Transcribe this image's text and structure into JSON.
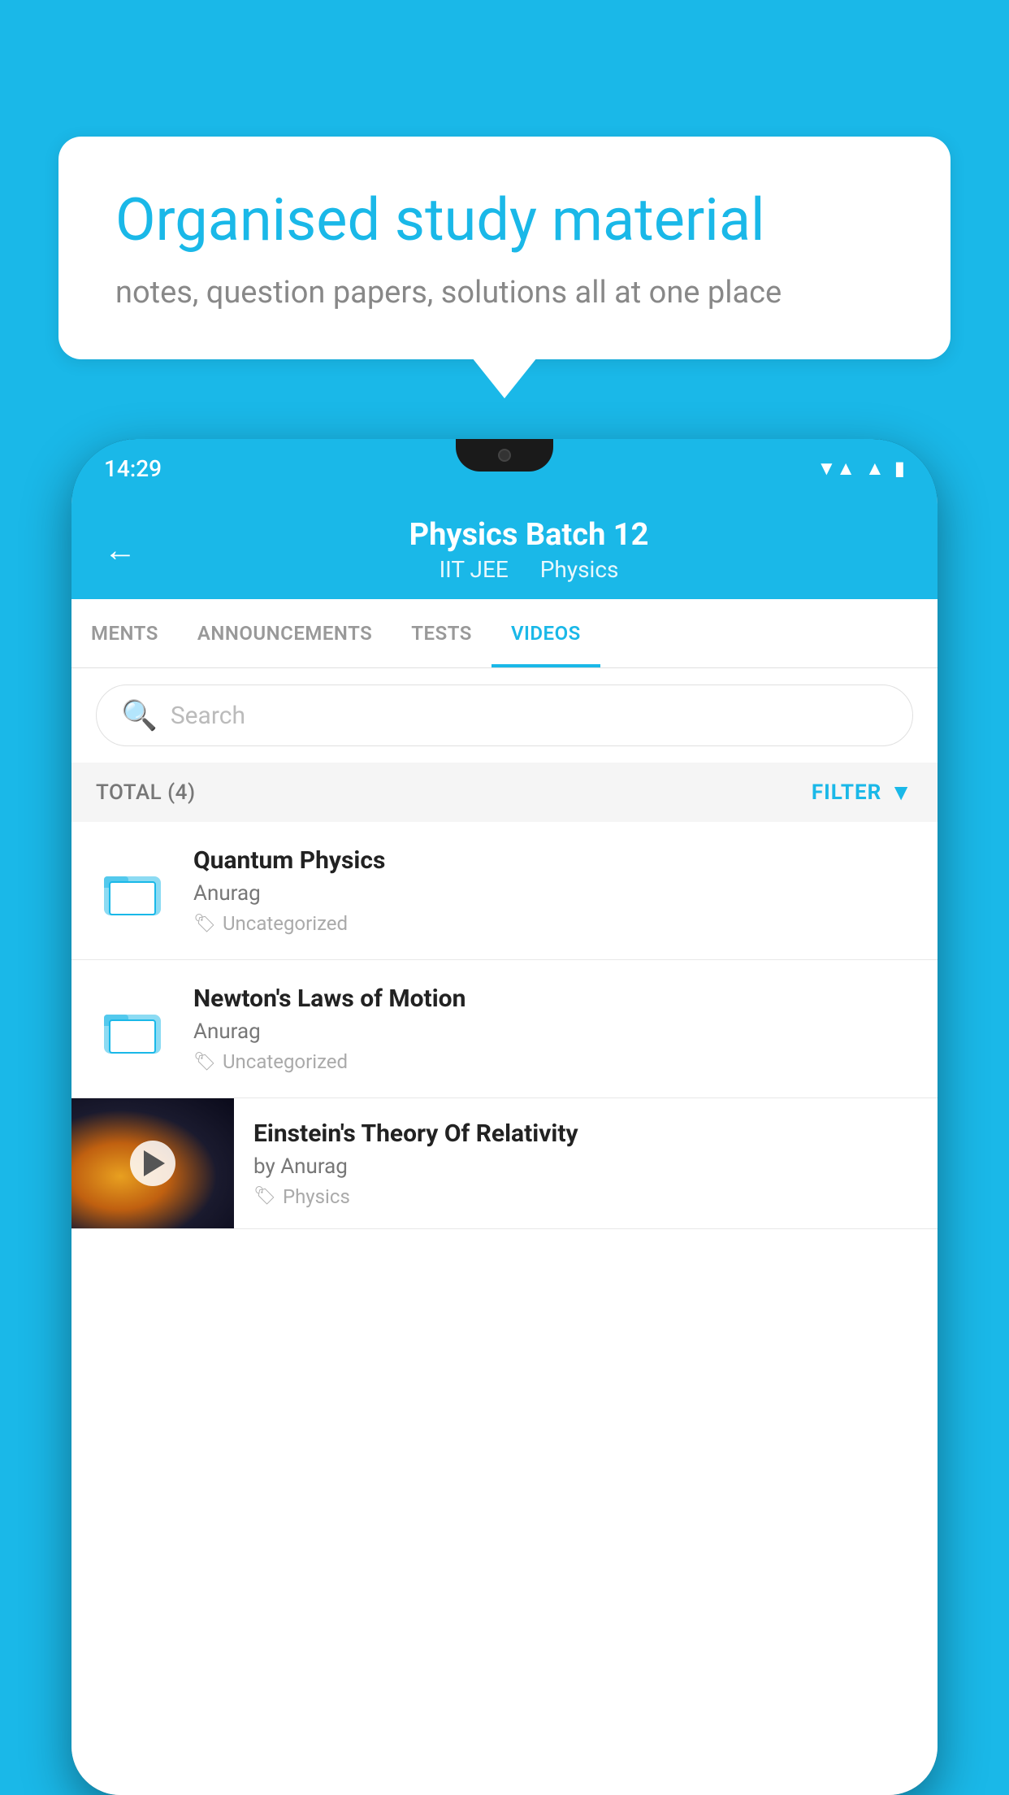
{
  "background_color": "#1ab8e8",
  "bubble": {
    "title": "Organised study material",
    "subtitle": "notes, question papers, solutions all at one place"
  },
  "phone": {
    "status_bar": {
      "time": "14:29",
      "icons": [
        "wifi",
        "signal",
        "battery"
      ]
    },
    "header": {
      "back_label": "←",
      "title": "Physics Batch 12",
      "subtitle_part1": "IIT JEE",
      "subtitle_part2": "Physics"
    },
    "tabs": [
      {
        "label": "MENTS",
        "active": false
      },
      {
        "label": "ANNOUNCEMENTS",
        "active": false
      },
      {
        "label": "TESTS",
        "active": false
      },
      {
        "label": "VIDEOS",
        "active": true
      }
    ],
    "search": {
      "placeholder": "Search"
    },
    "filter_row": {
      "total_label": "TOTAL (4)",
      "filter_label": "FILTER"
    },
    "items": [
      {
        "type": "folder",
        "title": "Quantum Physics",
        "author": "Anurag",
        "tag": "Uncategorized"
      },
      {
        "type": "folder",
        "title": "Newton's Laws of Motion",
        "author": "Anurag",
        "tag": "Uncategorized"
      },
      {
        "type": "video",
        "title": "Einstein's Theory Of Relativity",
        "author": "by Anurag",
        "tag": "Physics"
      }
    ]
  }
}
